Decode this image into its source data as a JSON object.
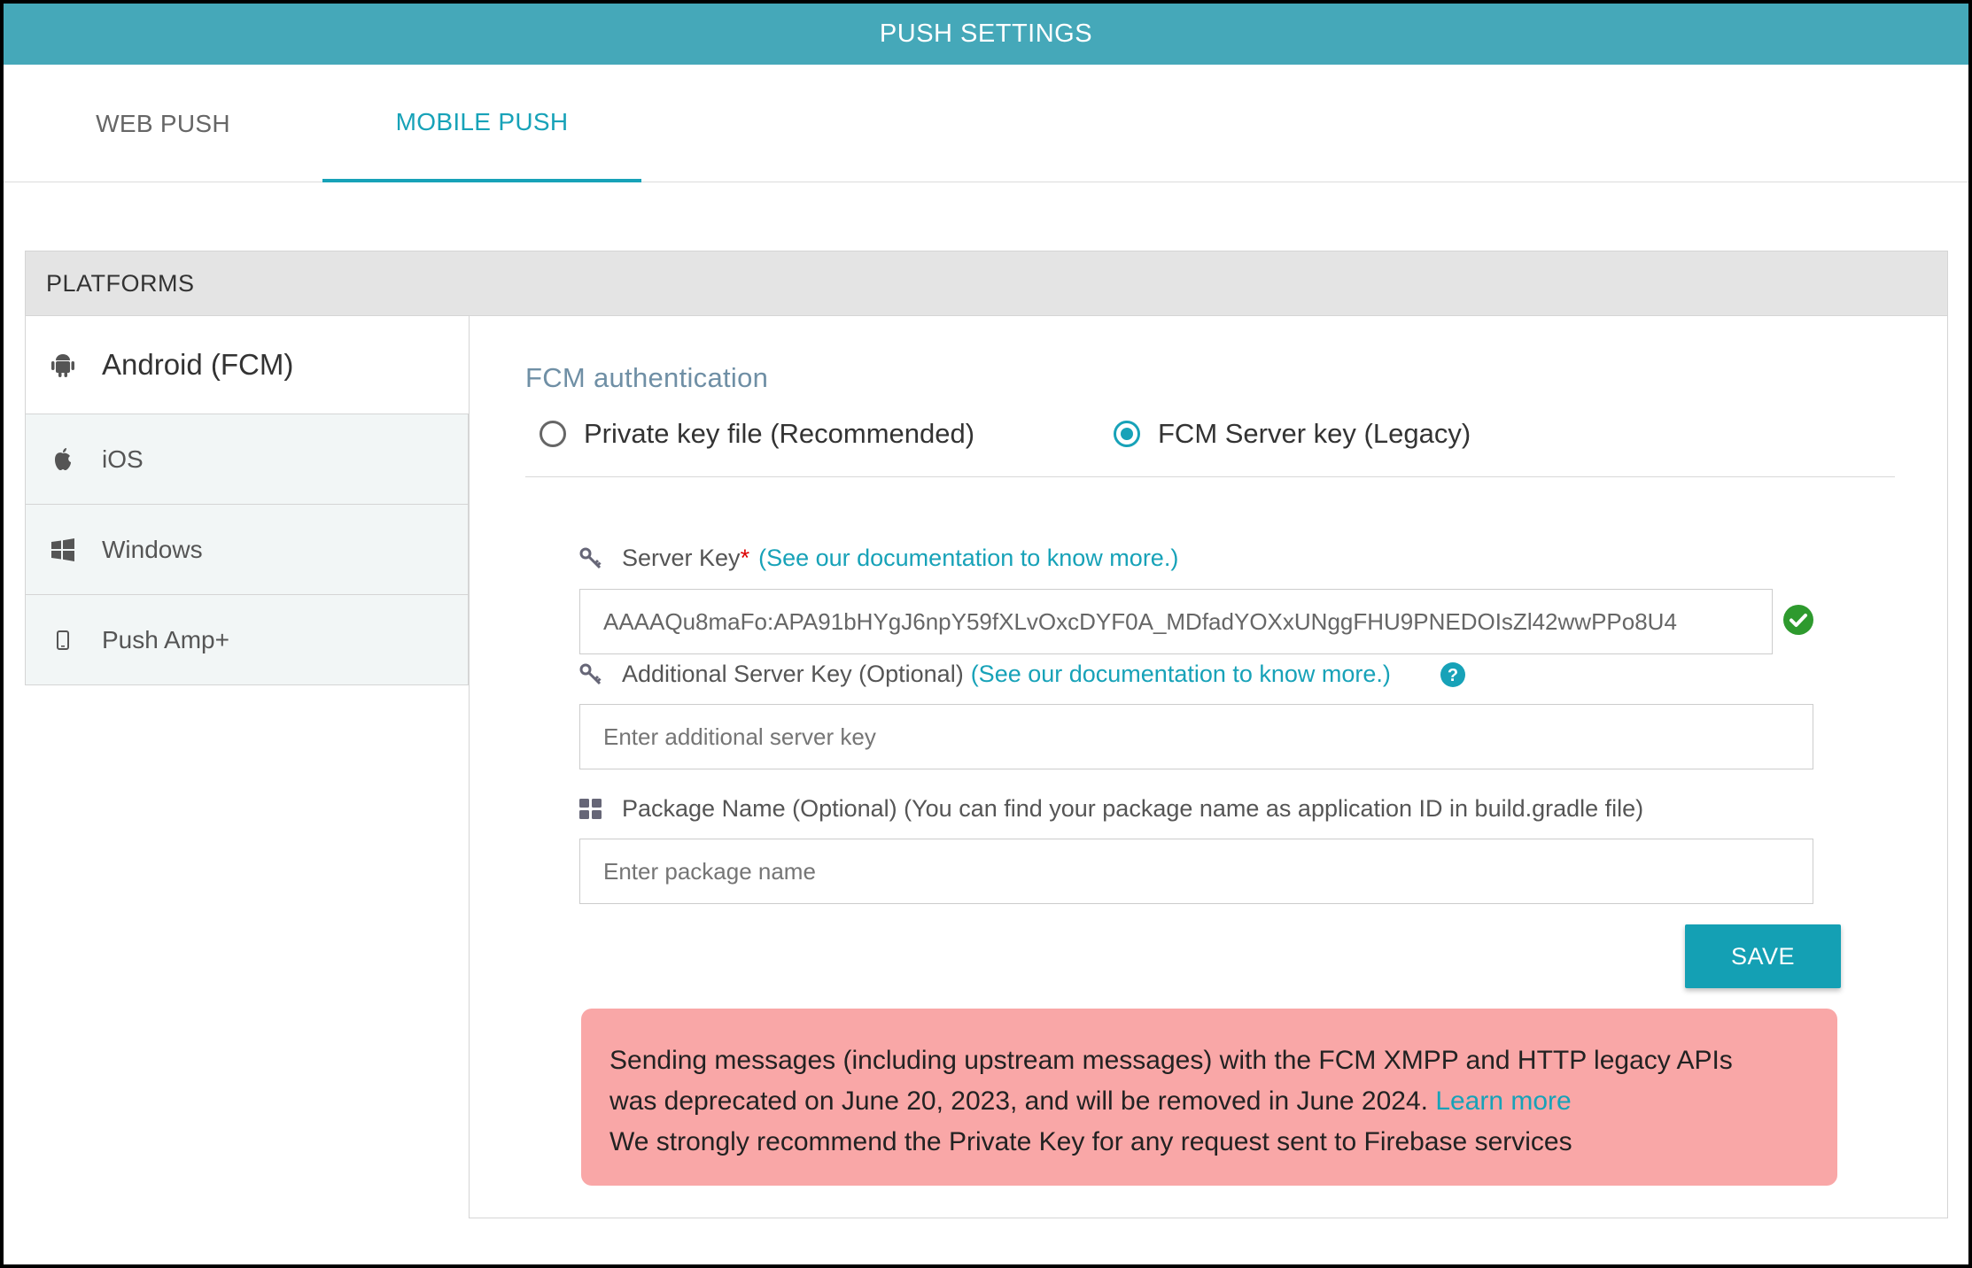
{
  "header": {
    "title": "PUSH SETTINGS"
  },
  "tabs": [
    {
      "label": "WEB PUSH"
    },
    {
      "label": "MOBILE PUSH"
    }
  ],
  "platforms": {
    "header": "PLATFORMS",
    "items": [
      {
        "label": "Android (FCM)",
        "icon": "android-icon"
      },
      {
        "label": "iOS",
        "icon": "apple-icon"
      },
      {
        "label": "Windows",
        "icon": "windows-icon"
      },
      {
        "label": "Push Amp+",
        "icon": "mobile-icon"
      }
    ]
  },
  "fcm": {
    "title": "FCM authentication",
    "options": [
      {
        "label": "Private key file (Recommended)",
        "selected": false
      },
      {
        "label": "FCM Server key (Legacy)",
        "selected": true
      }
    ]
  },
  "server_key": {
    "label": "Server Key",
    "required_mark": "*",
    "doc_link": "(See our documentation to know more.)",
    "value": "AAAAQu8maFo:APA91bHYgJ6npY59fXLvOxcDYF0A_MDfadYOXxUNggFHU9PNEDOIsZl42wwPPo8U4"
  },
  "additional_key": {
    "label": "Additional Server Key (Optional)",
    "doc_link": "(See our documentation to know more.)",
    "placeholder": "Enter additional server key"
  },
  "package": {
    "label": "Package Name (Optional) (You can find your package name as application ID in build.gradle file)",
    "placeholder": "Enter package name"
  },
  "save_label": "SAVE",
  "alert": {
    "line1": "Sending messages (including upstream messages) with the FCM XMPP and HTTP legacy APIs",
    "line2": "was deprecated on June 20, 2023, and will be removed in June 2024.",
    "link": "Learn more",
    "line3": "We strongly recommend the Private Key for any request sent to Firebase services"
  },
  "colors": {
    "accent": "#17a2b8",
    "header_bg": "#45a8b9",
    "alert_bg": "#f9a7a7",
    "success": "#2e9a2e"
  }
}
